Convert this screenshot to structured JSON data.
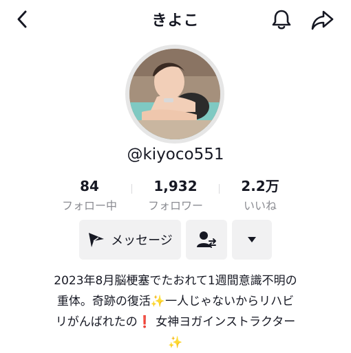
{
  "header": {
    "title": "きよこ"
  },
  "profile": {
    "username": "@kiyoco551",
    "stats": [
      {
        "value": "84",
        "label": "フォロー中"
      },
      {
        "value": "1,932",
        "label": "フォロワー"
      },
      {
        "value": "2.2万",
        "label": "いいね"
      }
    ]
  },
  "actions": {
    "message_label": "メッセージ"
  },
  "bio": {
    "line1": "2023年8月脳梗塞でたおれて1週間意識不明の",
    "line2a": "重体。奇跡の復活",
    "line2_emoji": "✨",
    "line2b": "一人じゃないからリハビ",
    "line3a": "リがんばれたの",
    "line3_emoji": "❗",
    "line3b": " 女神ヨガインストラクター",
    "line4_emoji": "✨"
  },
  "colors": {
    "text": "#161823",
    "muted": "#8a8b91",
    "button_bg": "#f1f1f2"
  }
}
